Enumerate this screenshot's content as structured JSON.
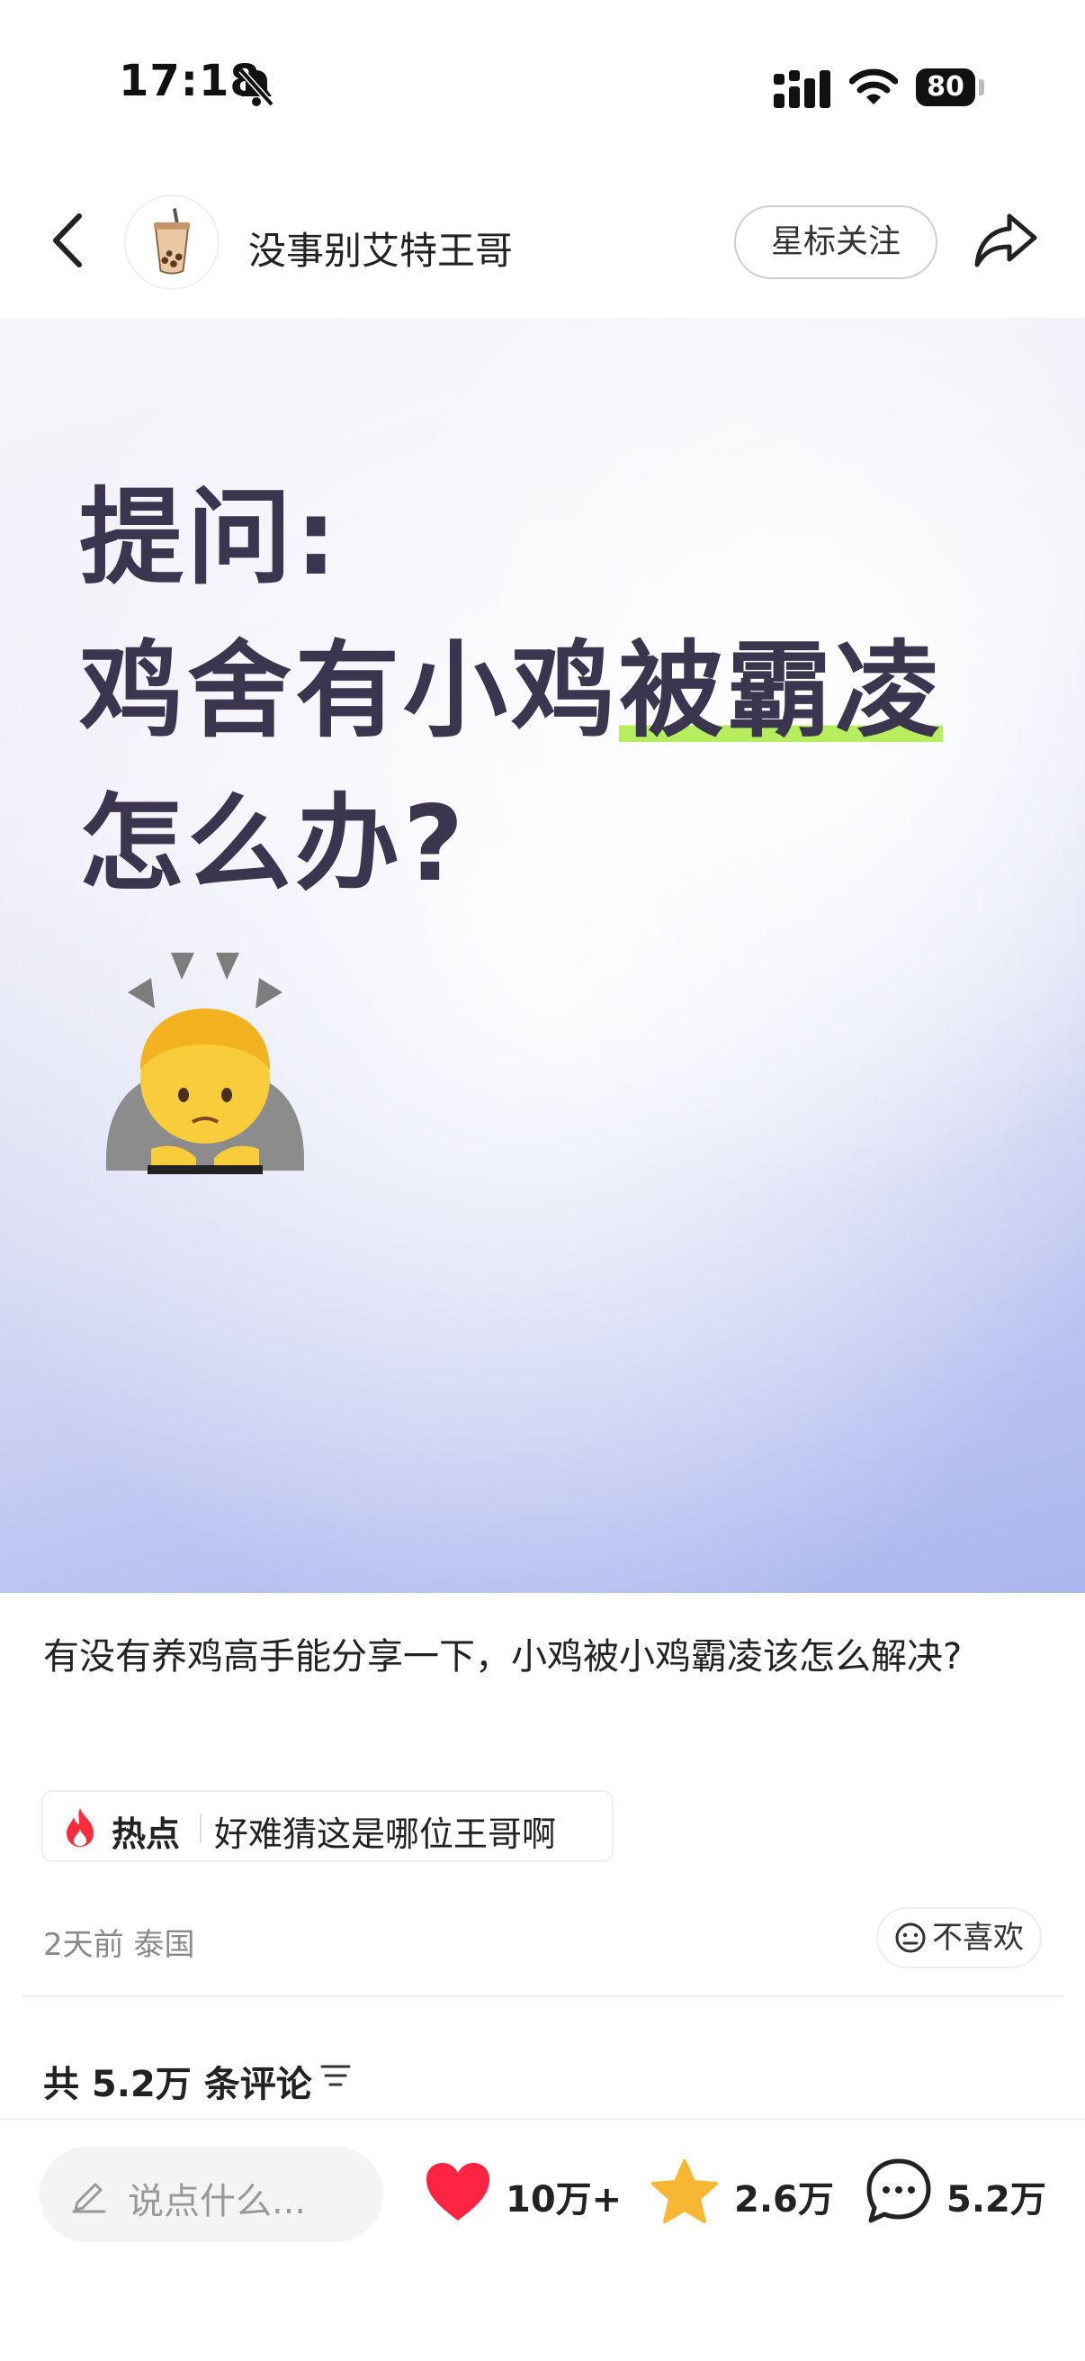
{
  "status_bar": {
    "time": "17:18",
    "battery": "80"
  },
  "header": {
    "author_name": "没事别艾特王哥",
    "follow_label": "星标关注"
  },
  "cover": {
    "line1": "提问:",
    "line2_a": "鸡舍有小鸡",
    "line2_b": "被霸凌",
    "line3": "怎么办?",
    "highlight_color": "#b7ee5f"
  },
  "post": {
    "description": "有没有养鸡高手能分享一下，小鸡被小鸡霸凌该怎么解决?",
    "hot_label": "热点",
    "hot_text": "好难猜这是哪位王哥啊",
    "meta": "2天前 泰国",
    "dislike_label": "不喜欢",
    "comment_count_label": "共 5.2万 条评论"
  },
  "bottom_bar": {
    "input_placeholder": "说点什么...",
    "likes": "10万+",
    "favorites": "2.6万",
    "comments": "5.2万"
  },
  "colors": {
    "like": "#ff2442",
    "favorite": "#f7b733",
    "cover_text": "#3b3550"
  },
  "icons": [
    "silent-bell-icon",
    "signal-icon",
    "wifi-icon",
    "battery-icon",
    "back-icon",
    "bubble-tea-avatar",
    "share-icon",
    "bowing-person-emoji",
    "fire-icon",
    "neutral-face-icon",
    "filter-icon",
    "pencil-icon",
    "heart-icon",
    "star-icon",
    "chat-bubble-icon"
  ]
}
